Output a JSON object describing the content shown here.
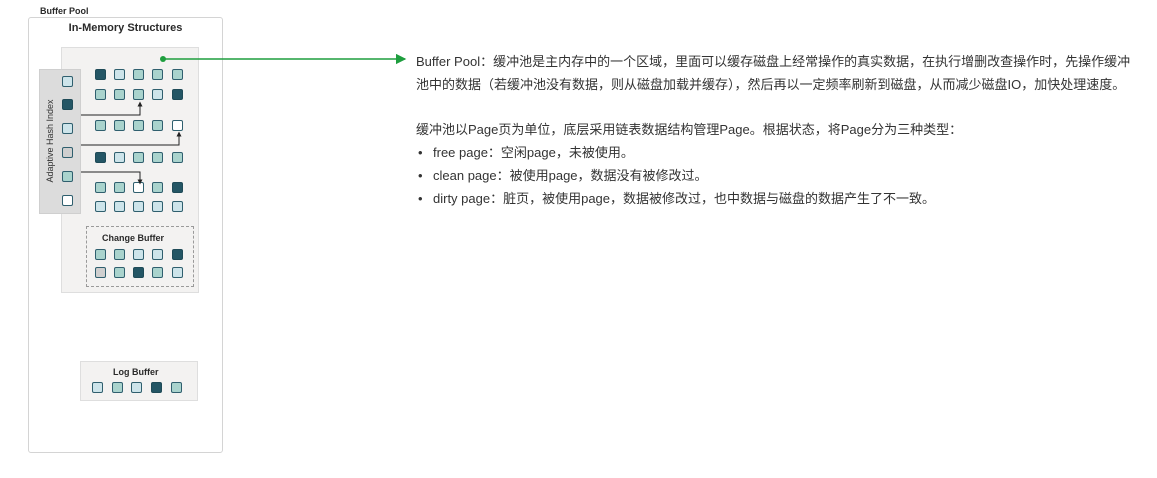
{
  "diagram": {
    "title": "In-Memory Structures",
    "buffer_pool": {
      "label": "Buffer Pool",
      "rows": [
        [
          "dark",
          "light",
          "mid",
          "mid",
          "mid"
        ],
        [
          "mid",
          "mid",
          "mid",
          "light",
          "dark"
        ],
        [
          "mid",
          "mid",
          "mid",
          "mid",
          "empty"
        ],
        [
          "dark",
          "light",
          "mid",
          "mid",
          "mid"
        ],
        [
          "mid",
          "mid",
          "empty",
          "mid",
          "dark"
        ],
        [
          "light",
          "light",
          "light",
          "light",
          "light"
        ]
      ]
    },
    "adaptive_hash_index": {
      "label": "Adaptive Hash Index",
      "cells": [
        "light",
        "dark",
        "light",
        "gray",
        "mid",
        "empty"
      ]
    },
    "change_buffer": {
      "label": "Change Buffer",
      "rows": [
        [
          "mid",
          "mid",
          "light",
          "light",
          "dark"
        ],
        [
          "gray",
          "mid",
          "dark",
          "mid",
          "light"
        ]
      ]
    },
    "log_buffer": {
      "label": "Log Buffer",
      "cells": [
        "light",
        "mid",
        "light",
        "dark",
        "mid"
      ]
    },
    "connector_color": "#1e9e3e"
  },
  "description": {
    "para1": "Buffer Pool：缓冲池是主内存中的一个区域，里面可以缓存磁盘上经常操作的真实数据，在执行增删改查操作时，先操作缓冲池中的数据（若缓冲池没有数据，则从磁盘加载并缓存），然后再以一定频率刷新到磁盘，从而减少磁盘IO，加快处理速度。",
    "para2": "缓冲池以Page页为单位，底层采用链表数据结构管理Page。根据状态，将Page分为三种类型：",
    "bullet_char": "•",
    "bullets": [
      "free page：空闲page，未被使用。",
      "clean page：被使用page，数据没有被修改过。",
      "dirty page：脏页，被使用page，数据被修改过，也中数据与磁盘的数据产生了不一致。"
    ]
  }
}
